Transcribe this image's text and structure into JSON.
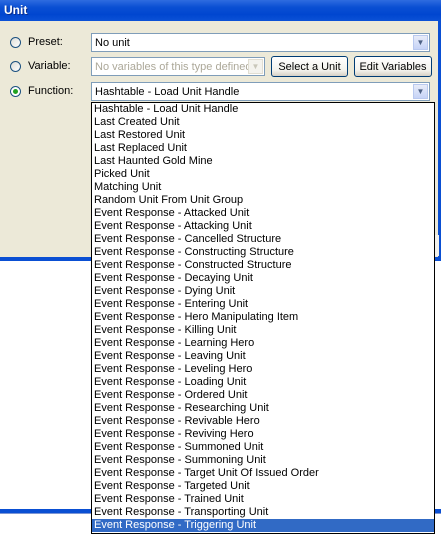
{
  "window": {
    "title": "Unit"
  },
  "rows": {
    "preset": {
      "label": "Preset:",
      "value": "No unit",
      "checked": false
    },
    "variable": {
      "label": "Variable:",
      "value": "No variables of this type defined",
      "checked": false,
      "select_button": "Select a Unit",
      "edit_button": "Edit Variables"
    },
    "function": {
      "label": "Function:",
      "value": "Hashtable - Load Unit Handle",
      "checked": true
    }
  },
  "dropdown": {
    "items": [
      "Hashtable - Load Unit Handle",
      "Last Created Unit",
      "Last Restored Unit",
      "Last Replaced Unit",
      "Last Haunted Gold Mine",
      "Picked Unit",
      "Matching Unit",
      "Random Unit From Unit Group",
      "Event Response - Attacked Unit",
      "Event Response - Attacking Unit",
      "Event Response - Cancelled Structure",
      "Event Response - Constructing Structure",
      "Event Response - Constructed Structure",
      "Event Response - Decaying Unit",
      "Event Response - Dying Unit",
      "Event Response - Entering Unit",
      "Event Response - Hero Manipulating Item",
      "Event Response - Killing Unit",
      "Event Response - Learning Hero",
      "Event Response - Leaving Unit",
      "Event Response - Leveling Hero",
      "Event Response - Loading Unit",
      "Event Response - Ordered Unit",
      "Event Response - Researching Unit",
      "Event Response - Revivable Hero",
      "Event Response - Reviving Hero",
      "Event Response - Summoned Unit",
      "Event Response - Summoning Unit",
      "Event Response - Target Unit Of Issued Order",
      "Event Response - Targeted Unit",
      "Event Response - Trained Unit",
      "Event Response - Transporting Unit",
      "Event Response - Triggering Unit"
    ],
    "selected_index": 32
  },
  "colors": {
    "titlebar": "#0a4fd3",
    "dialog_bg": "#ece9d8",
    "selection": "#316ac5"
  },
  "icons": {
    "dropdown_arrow": "chevron-down-icon"
  }
}
